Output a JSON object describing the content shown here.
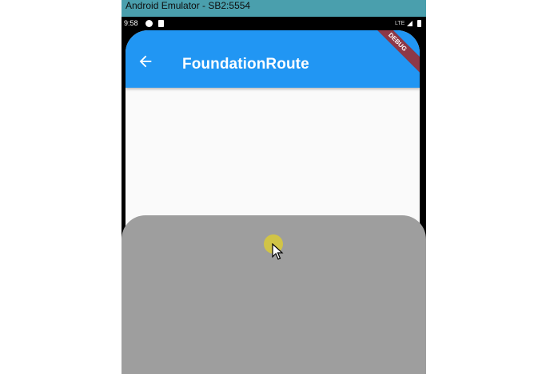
{
  "window": {
    "title": "Android Emulator - SB2:5554"
  },
  "status_bar": {
    "time": "9:58",
    "network": "LTE",
    "icons": [
      "cast-icon",
      "sd-card-icon",
      "signal-icon",
      "battery-icon"
    ]
  },
  "app_bar": {
    "title": "FoundationRoute",
    "back_icon": "arrow-back-icon",
    "color": "#2196f3"
  },
  "debug_banner": {
    "label": "DEBUG"
  },
  "bottom_sheet": {
    "color": "#9e9e9e"
  },
  "colors": {
    "titlebar": "#4a9fad",
    "screen_background": "#fafafa",
    "touch_indicator": "#d6c83c"
  }
}
